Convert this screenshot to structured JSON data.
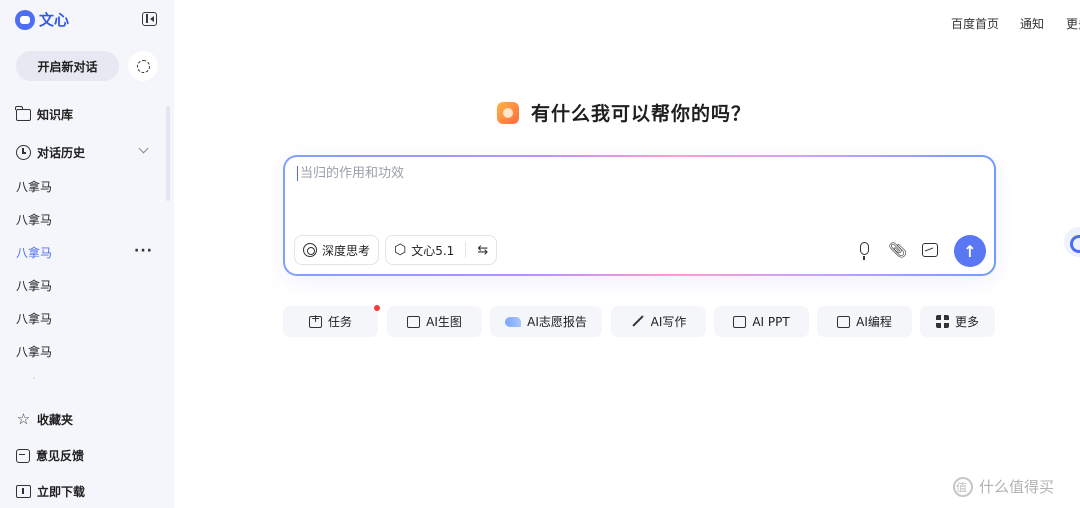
{
  "brand": {
    "name": "文心"
  },
  "sidebar": {
    "new_chat": "开启新对话",
    "knowledge": "知识库",
    "history": "对话历史",
    "history_items": [
      "八拿马",
      "八拿马",
      "八拿马",
      "八拿马",
      "八拿马",
      "八拿马"
    ],
    "active_index": 2,
    "active_more": "···",
    "favorites": "收藏夹",
    "feedback": "意见反馈",
    "download": "立即下载"
  },
  "topnav": {
    "items": [
      "百度首页",
      "通知",
      "更多"
    ]
  },
  "main": {
    "greeting": "有什么我可以帮你的吗？",
    "input_placeholder": "当归的作用和功效",
    "deep_think": "深度思考",
    "model": "文心5.1",
    "swap_icon": "⇆",
    "send_icon": "↑"
  },
  "quick_actions": [
    {
      "label": "任务",
      "icon": "task-icon"
    },
    {
      "label": "AI生图",
      "icon": "image-gen-icon"
    },
    {
      "label": "AI志愿报告",
      "icon": "bird-icon"
    },
    {
      "label": "AI写作",
      "icon": "pen-icon"
    },
    {
      "label": "AI PPT",
      "icon": "ppt-icon"
    },
    {
      "label": "AI编程",
      "icon": "code-icon"
    },
    {
      "label": "更多",
      "icon": "grid-icon"
    }
  ],
  "watermark": {
    "text": "什么值得买"
  },
  "colors": {
    "accent": "#4e6ef2",
    "sidebar_bg": "#f4f6fb",
    "send": "#5a77f4",
    "badge": "#f23b3b"
  }
}
